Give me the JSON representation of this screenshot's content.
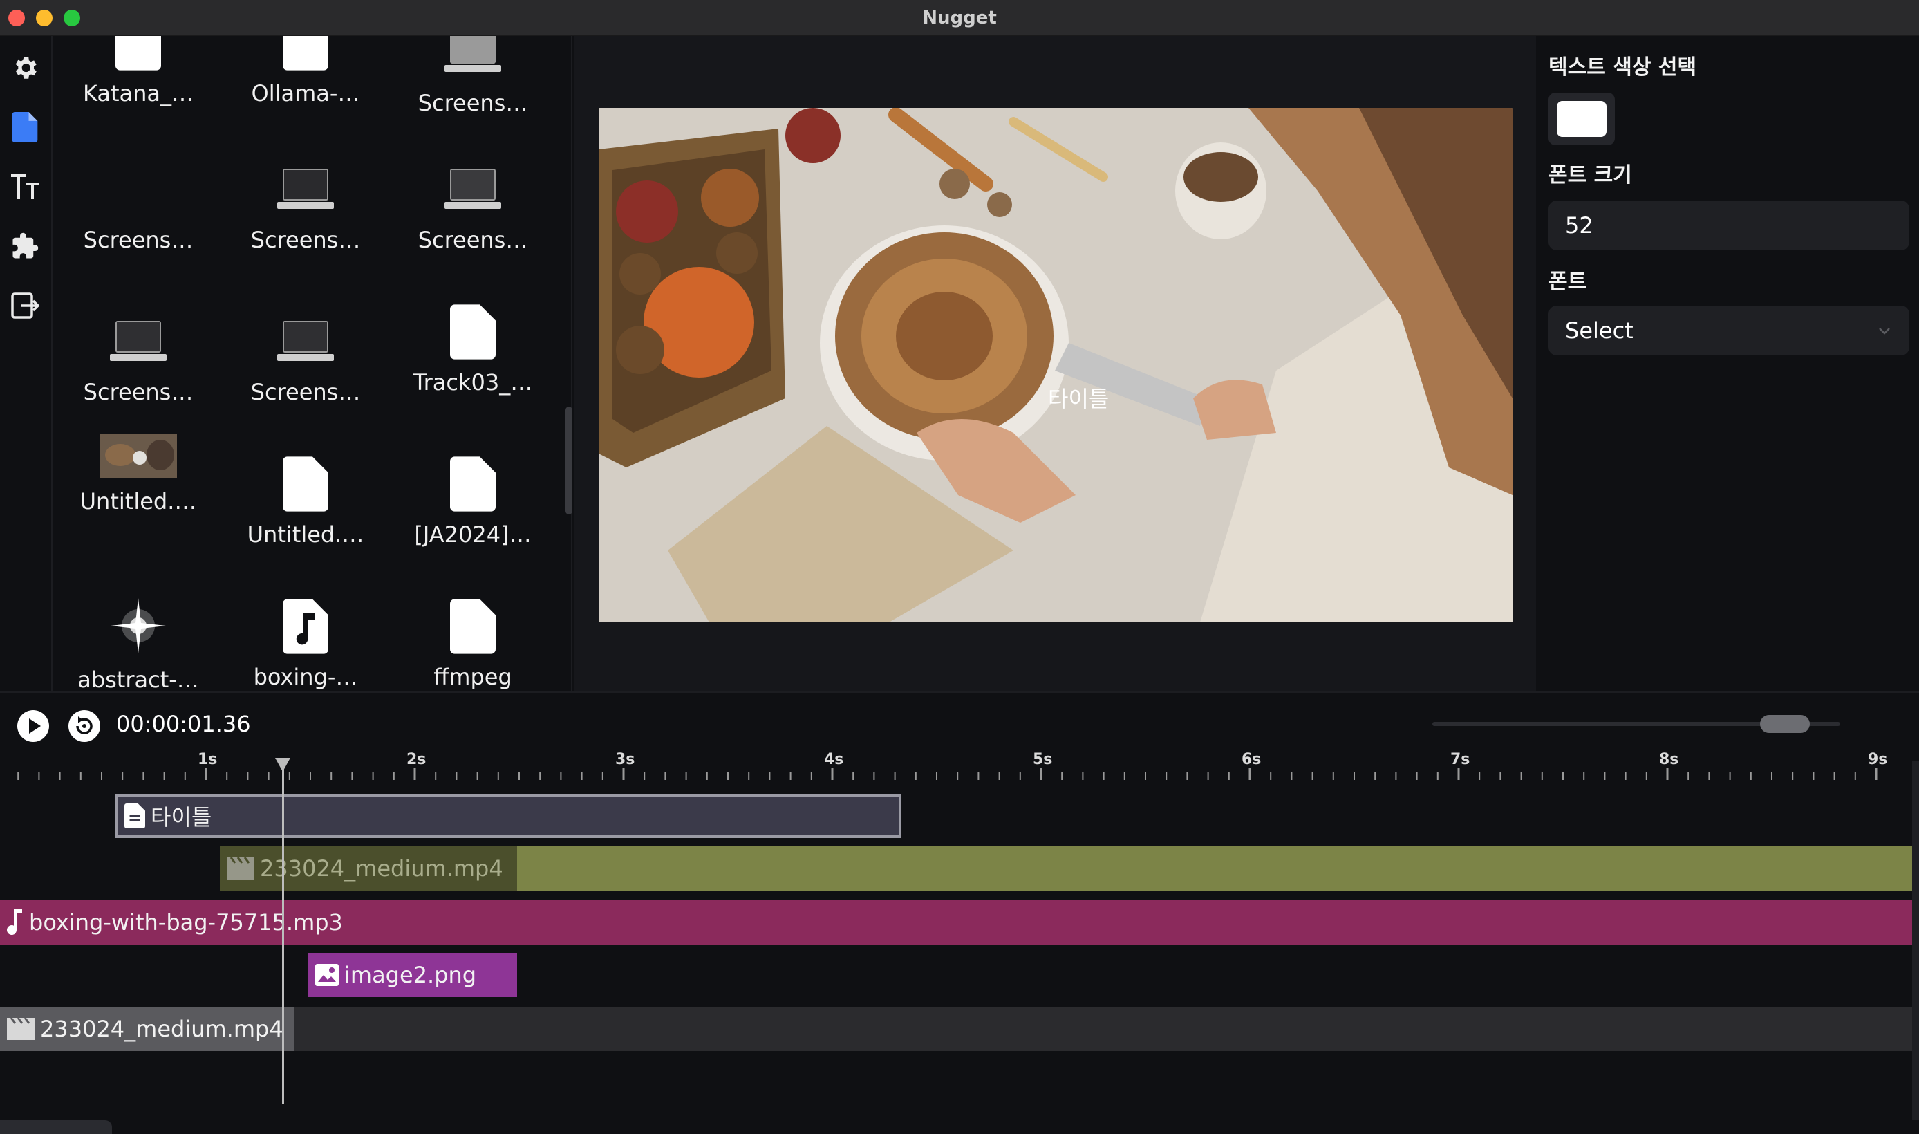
{
  "window": {
    "title": "Nugget"
  },
  "rail": {
    "items": [
      "settings",
      "files",
      "text",
      "plugins",
      "export"
    ]
  },
  "files": [
    {
      "name": "Katana_…",
      "icon": "document-icon"
    },
    {
      "name": "Ollama-…",
      "icon": "document-icon"
    },
    {
      "name": "Screens…",
      "icon": "laptop-icon"
    },
    {
      "name": "Screens…",
      "icon": "blank"
    },
    {
      "name": "Screens…",
      "icon": "laptop-icon"
    },
    {
      "name": "Screens…",
      "icon": "laptop-icon"
    },
    {
      "name": "Screens…",
      "icon": "laptop-icon"
    },
    {
      "name": "Screens…",
      "icon": "laptop-icon"
    },
    {
      "name": "Track03_…",
      "icon": "document-icon"
    },
    {
      "name": "Untitled.…",
      "icon": "thumbnail"
    },
    {
      "name": "Untitled.…",
      "icon": "document-icon"
    },
    {
      "name": "[JA2024]…",
      "icon": "document-icon"
    },
    {
      "name": "abstract-…",
      "icon": "sparkle-thumbnail"
    },
    {
      "name": "boxing-…",
      "icon": "music-file-icon"
    },
    {
      "name": "ffmpeg",
      "icon": "document-icon"
    }
  ],
  "preview": {
    "overlay_text": "타이틀"
  },
  "inspector": {
    "color_label": "텍스트 색상 선택",
    "color_value": "#ffffff",
    "font_size_label": "폰트 크기",
    "font_size_value": "52",
    "font_label": "폰트",
    "font_value": "Select"
  },
  "transport": {
    "timecode": "00:00:01.36",
    "zoom_level": 0.8
  },
  "ruler": {
    "labels": [
      "1s",
      "2s",
      "3s",
      "4s",
      "5s",
      "6s",
      "7s",
      "8s",
      "9s"
    ]
  },
  "tracks": [
    {
      "label": "타이틀",
      "type": "text",
      "color": "#3b3a4a"
    },
    {
      "label": "233024_medium.mp4",
      "type": "video",
      "color": "#7c8447"
    },
    {
      "label": "boxing-with-bag-75715.mp3",
      "type": "audio",
      "color": "#8b2a5c"
    },
    {
      "label": "image2.png",
      "type": "image",
      "color": "#8e3596"
    },
    {
      "label": "233024_medium.mp4",
      "type": "video",
      "color": "#5a5a5e"
    }
  ]
}
